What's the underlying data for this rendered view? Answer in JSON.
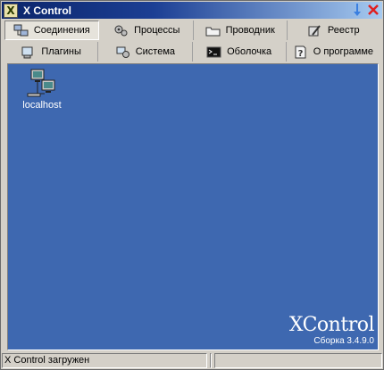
{
  "window": {
    "title": "X Control",
    "app_icon_letter": "X"
  },
  "tabs_row1": [
    {
      "label": "Соединения",
      "icon": "connections-icon"
    },
    {
      "label": "Процессы",
      "icon": "processes-icon"
    },
    {
      "label": "Проводник",
      "icon": "explorer-icon"
    },
    {
      "label": "Реестр",
      "icon": "registry-icon"
    }
  ],
  "tabs_row2": [
    {
      "label": "Плагины",
      "icon": "plugins-icon"
    },
    {
      "label": "Система",
      "icon": "system-icon"
    },
    {
      "label": "Оболочка",
      "icon": "shell-icon"
    },
    {
      "label": "О программе",
      "icon": "about-icon"
    }
  ],
  "desktop": {
    "host_label": "localhost",
    "brand_name": "XControl",
    "brand_build": "Сборка 3.4.9.0"
  },
  "status": {
    "text": "X Control загружен",
    "panel2": "",
    "panel3": ""
  },
  "colors": {
    "desktop_bg": "#3e68b0",
    "title_bar": "#0a246a"
  }
}
